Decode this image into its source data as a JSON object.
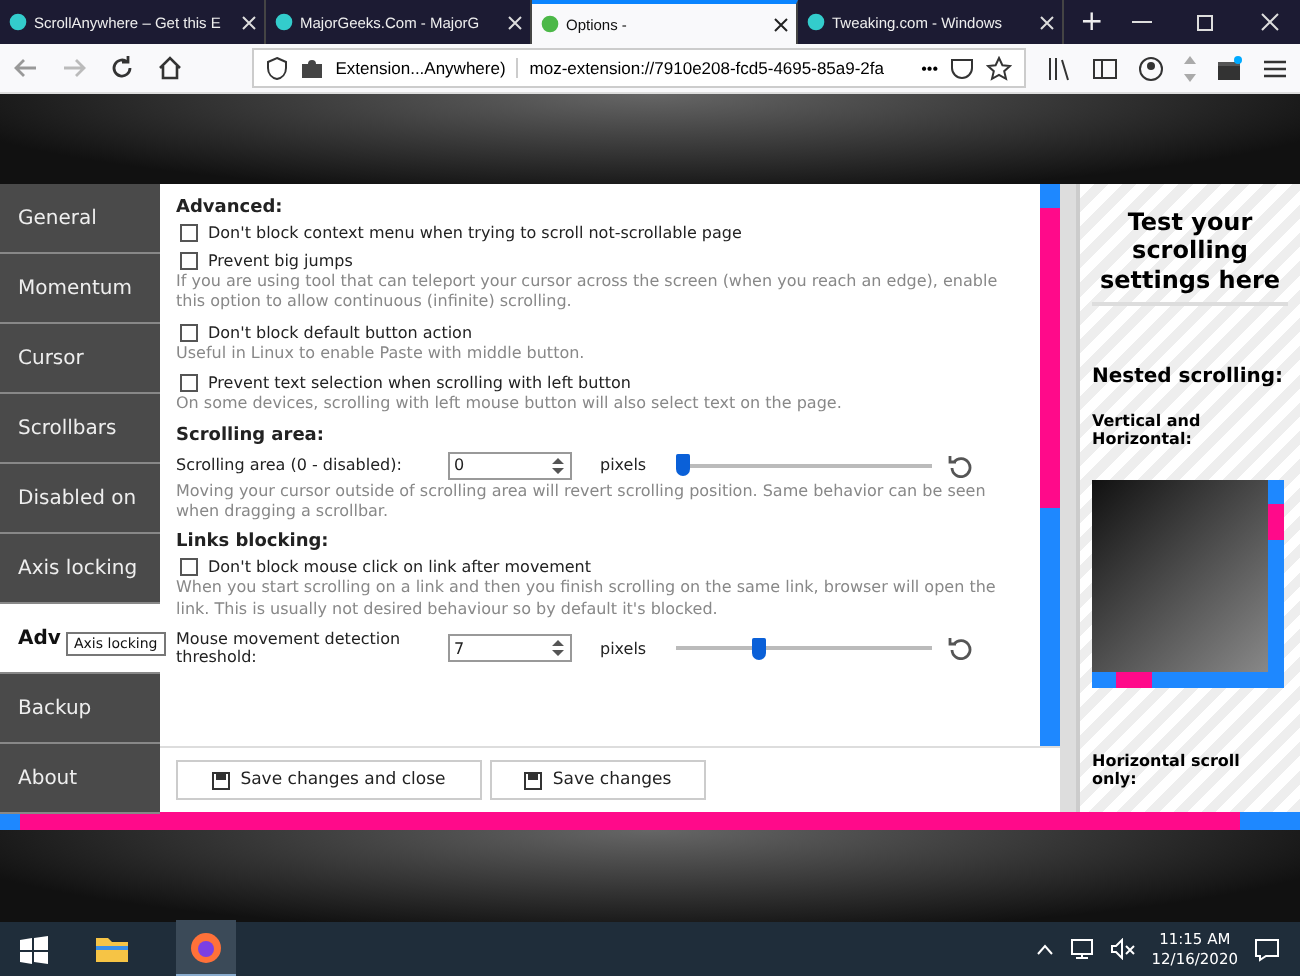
{
  "browser": {
    "tabs": [
      {
        "title": "ScrollAnywhere – Get this E",
        "selected": false
      },
      {
        "title": "MajorGeeks.Com - MajorG",
        "selected": false
      },
      {
        "title": "Options -",
        "selected": true
      },
      {
        "title": "Tweaking.com - Windows",
        "selected": false
      }
    ],
    "new_tab": "+",
    "identity": "Extension...Anywhere)",
    "url": "moz-extension://7910e208-fcd5-4695-85a9-2fa",
    "page_actions": "•••"
  },
  "sidebar": {
    "items": [
      {
        "label": "General",
        "selected": false
      },
      {
        "label": "Momentum",
        "selected": false
      },
      {
        "label": "Cursor",
        "selected": false
      },
      {
        "label": "Scrollbars",
        "selected": false
      },
      {
        "label": "Disabled on",
        "selected": false
      },
      {
        "label": "Axis locking",
        "selected": false
      },
      {
        "label": "Adv",
        "selected": true
      },
      {
        "label": "Backup",
        "selected": false
      },
      {
        "label": "About",
        "selected": false
      }
    ],
    "tooltip": "Axis locking"
  },
  "sections": [
    {
      "heading": "Advanced:",
      "options": [
        {
          "kind": "checkbox",
          "label": "Don't block context menu when trying to scroll not-scrollable page",
          "checked": false
        },
        {
          "kind": "checkbox",
          "label": "Prevent big jumps",
          "checked": false,
          "help": "If you are using tool that can teleport your cursor across the screen (when you reach an edge), enable this option to allow continuous (infinite) scrolling."
        },
        {
          "kind": "checkbox",
          "label": "Don't block default button action",
          "checked": false,
          "help": "Useful in Linux to enable Paste with middle button."
        },
        {
          "kind": "checkbox",
          "label": "Prevent text selection when scrolling with left button",
          "checked": false,
          "help": "On some devices, scrolling with left mouse button will also select text on the page."
        }
      ]
    },
    {
      "heading": "Scrolling area:",
      "options": [
        {
          "kind": "slider",
          "label": "Scrolling area (0 - disabled):",
          "value": "0",
          "unit": "pixels",
          "level": 0.0,
          "help": "Moving your cursor outside of scrolling area will revert scrolling position. Same behavior can be seen when dragging a scrollbar."
        }
      ]
    },
    {
      "heading": "Links blocking:",
      "options": [
        {
          "kind": "checkbox",
          "label": "Don't block mouse click on link after movement",
          "checked": false,
          "help": "When you start scrolling on a link and then you finish scrolling on the same link, browser will open the link. This is usually not desired behaviour so by default it's blocked."
        },
        {
          "kind": "slider",
          "label": "Mouse movement detection threshold:",
          "value": "7",
          "unit": "pixels",
          "level": 0.32
        }
      ]
    }
  ],
  "buttons": [
    "Save changes and close",
    "Save changes"
  ],
  "test_panel": {
    "title": "Test your scrolling settings here",
    "nested_heading": "Nested scrolling:",
    "vh_label": "Vertical and Horizontal:",
    "h_label": "Horizontal scroll only:"
  },
  "taskbar": {
    "time": "11:15 AM",
    "date": "12/16/2020"
  }
}
